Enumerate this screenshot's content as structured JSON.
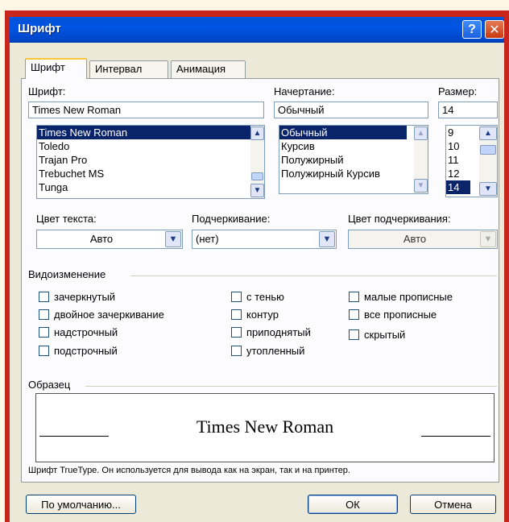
{
  "window": {
    "title": "Шрифт"
  },
  "tabs": [
    {
      "label": "Шрифт"
    },
    {
      "label": "Интервал"
    },
    {
      "label": "Анимация"
    }
  ],
  "font": {
    "label": "Шрифт:",
    "value": "Times New Roman",
    "list": [
      "Times New Roman",
      "Toledo",
      "Trajan Pro",
      "Trebuchet MS",
      "Tunga"
    ],
    "selected": "Times New Roman"
  },
  "style": {
    "label": "Начертание:",
    "value": "Обычный",
    "list": [
      "Обычный",
      "Курсив",
      "Полужирный",
      "Полужирный Курсив"
    ],
    "selected": "Обычный"
  },
  "size": {
    "label": "Размер:",
    "value": "14",
    "list": [
      "9",
      "10",
      "11",
      "12",
      "14"
    ],
    "selected": "14"
  },
  "text_color": {
    "label": "Цвет текста:",
    "value": "Авто"
  },
  "underline": {
    "label": "Подчеркивание:",
    "value": "(нет)"
  },
  "underline_color": {
    "label": "Цвет подчеркивания:",
    "value": "Авто"
  },
  "effects": {
    "label": "Видоизменение",
    "col1": [
      "зачеркнутый",
      "двойное зачеркивание",
      "надстрочный",
      "подстрочный"
    ],
    "col2": [
      "с тенью",
      "контур",
      "приподнятый",
      "утопленный"
    ],
    "col3": [
      "малые прописные",
      "все прописные",
      "скрытый"
    ]
  },
  "preview": {
    "label": "Образец",
    "text": "Times New Roman",
    "note": "Шрифт TrueType. Он используется для вывода как на экран, так и на принтер."
  },
  "buttons": {
    "default": "По умолчанию...",
    "ok": "ОК",
    "cancel": "Отмена"
  },
  "colors": {
    "titlebar": "#0055e5",
    "selection": "#0a246a",
    "frame": "#c8261c"
  }
}
